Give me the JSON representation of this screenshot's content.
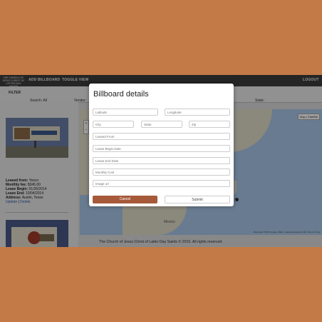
{
  "app": {
    "logo_text": "THE CHURCH OF JESUS CHRIST OF LATTER-DAY SAINTS",
    "nav": {
      "add_billboard": "ADD BILLBOARD",
      "toggle_view": "TOGGLE VIEW",
      "logout": "LOGOUT"
    }
  },
  "filter": {
    "label": "FILTER",
    "search": "Search: All",
    "vendor": "Vendor:",
    "state": "State:"
  },
  "billboard": {
    "leased_from_label": "Leased from:",
    "leased_from": "Yesco",
    "monthly_fee_label": "Monthly fee:",
    "monthly_fee": "$345.00",
    "lease_begin_label": "Lease Begin:",
    "lease_begin": "01/26/2014",
    "lease_end_label": "Lease End:",
    "lease_end": "10/04/2014",
    "address_label": "Address:",
    "address": "Austin, Texas",
    "update": "Update",
    "separator": "|",
    "delete": "Delete"
  },
  "map": {
    "map_btn": "Map",
    "satellite_btn": "Satellite",
    "zoom_in": "+",
    "zoom_out": "−",
    "mexico_label": "Mexico",
    "attribution": "Map data ©2015 Google, INEGI, Inav/Geosistemas SRL  Terms of Use"
  },
  "footer": {
    "text": "The Church of Jesus Christ of Latter Day Saints © 2015. All rights reserved."
  },
  "modal": {
    "title": "Billboard details",
    "latitude": "Latitude",
    "longitude": "Longitude",
    "city": "City",
    "state": "State",
    "zip": "Zip",
    "leased_from": "Leased From",
    "lease_begin": "Lease Begin Date",
    "lease_end": "Lease End Date",
    "monthly_cost": "Monthly Cost",
    "image_url": "Image url",
    "cancel": "Cancel",
    "submit": "Submit"
  },
  "colors": {
    "page_bg": "#c47a46",
    "cancel_bg": "#a65a3a",
    "topbar_bg": "#3d3d3d"
  }
}
